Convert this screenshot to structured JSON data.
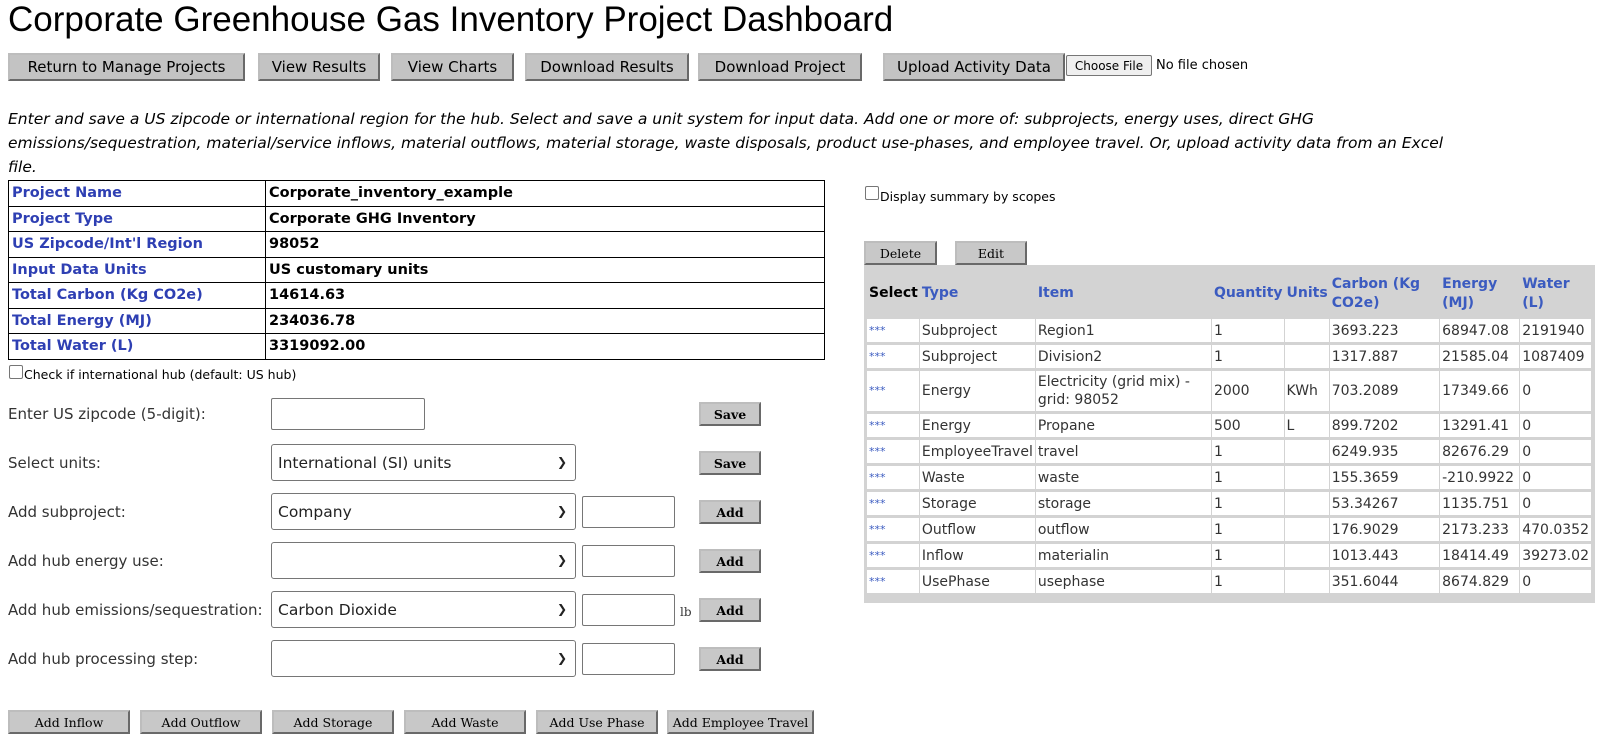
{
  "title": "Corporate Greenhouse Gas Inventory Project Dashboard",
  "toolbar": {
    "return_label": "Return to Manage Projects",
    "view_results_label": "View Results",
    "view_charts_label": "View Charts",
    "download_results_label": "Download Results",
    "download_project_label": "Download Project",
    "upload_label": "Upload Activity Data",
    "choose_file_label": "Choose File",
    "no_file_label": "No file chosen"
  },
  "intro": "Enter and save a US zipcode or international region for the hub. Select and save a unit system for input data. Add one or more of: subprojects, energy uses, direct GHG emissions/sequestration, material/service inflows, material outflows, material storage, waste disposals, product use-phases, and employee travel. Or, upload activity data from an Excel file.",
  "project": {
    "rows": [
      {
        "key": "Project Name",
        "value": "Corporate_inventory_example"
      },
      {
        "key": "Project Type",
        "value": "Corporate GHG Inventory"
      },
      {
        "key": "US Zipcode/Int'l Region",
        "value": "98052"
      },
      {
        "key": "Input Data Units",
        "value": "US customary units"
      },
      {
        "key": "Total Carbon (Kg CO2e)",
        "value": "14614.63"
      },
      {
        "key": "Total Energy (MJ)",
        "value": "234036.78"
      },
      {
        "key": "Total Water (L)",
        "value": "3319092.00"
      }
    ]
  },
  "intl_check_label": "Check if international hub (default: US hub)",
  "form": {
    "zip_label": "Enter US zipcode (5-digit):",
    "units_label": "Select units:",
    "units_value": "International (SI) units",
    "subproject_label": "Add subproject:",
    "subproject_value": "Company",
    "energy_label": "Add hub energy use:",
    "energy_value": "",
    "emissions_label": "Add hub emissions/sequestration:",
    "emissions_value": "Carbon Dioxide",
    "emissions_unit": "lb",
    "processing_label": "Add hub processing step:",
    "processing_value": "",
    "save_label": "Save",
    "add_label": "Add"
  },
  "bottom_buttons": {
    "inflow": "Add Inflow",
    "outflow": "Add Outflow",
    "storage": "Add Storage",
    "waste": "Add Waste",
    "use_phase": "Add Use Phase",
    "employee_travel": "Add Employee Travel"
  },
  "summary": {
    "scopes_label": "Display summary by scopes",
    "delete_label": "Delete",
    "edit_label": "Edit",
    "headers": {
      "select": "Select",
      "type": "Type",
      "item": "Item",
      "quantity": "Quantity",
      "units": "Units",
      "carbon": "Carbon (Kg CO2e)",
      "energy": "Energy (MJ)",
      "water": "Water (L)"
    },
    "rows": [
      {
        "select": "***",
        "type": "Subproject",
        "item": "Region1",
        "quantity": "1",
        "units": "",
        "carbon": "3693.223",
        "energy": "68947.08",
        "water": "2191940"
      },
      {
        "select": "***",
        "type": "Subproject",
        "item": "Division2",
        "quantity": "1",
        "units": "",
        "carbon": "1317.887",
        "energy": "21585.04",
        "water": "1087409"
      },
      {
        "select": "***",
        "type": "Energy",
        "item": "Electricity (grid mix) - grid: 98052",
        "quantity": "2000",
        "units": "KWh",
        "carbon": "703.2089",
        "energy": "17349.66",
        "water": "0"
      },
      {
        "select": "***",
        "type": "Energy",
        "item": "Propane",
        "quantity": "500",
        "units": "L",
        "carbon": "899.7202",
        "energy": "13291.41",
        "water": "0"
      },
      {
        "select": "***",
        "type": "EmployeeTravel",
        "item": "travel",
        "quantity": "1",
        "units": "",
        "carbon": "6249.935",
        "energy": "82676.29",
        "water": "0"
      },
      {
        "select": "***",
        "type": "Waste",
        "item": "waste",
        "quantity": "1",
        "units": "",
        "carbon": "155.3659",
        "energy": "-210.9922",
        "water": "0"
      },
      {
        "select": "***",
        "type": "Storage",
        "item": "storage",
        "quantity": "1",
        "units": "",
        "carbon": "53.34267",
        "energy": "1135.751",
        "water": "0"
      },
      {
        "select": "***",
        "type": "Outflow",
        "item": "outflow",
        "quantity": "1",
        "units": "",
        "carbon": "176.9029",
        "energy": "2173.233",
        "water": "470.0352"
      },
      {
        "select": "***",
        "type": "Inflow",
        "item": "materialin",
        "quantity": "1",
        "units": "",
        "carbon": "1013.443",
        "energy": "18414.49",
        "water": "39273.02"
      },
      {
        "select": "***",
        "type": "UsePhase",
        "item": "usephase",
        "quantity": "1",
        "units": "",
        "carbon": "351.6044",
        "energy": "8674.829",
        "water": "0"
      }
    ]
  }
}
